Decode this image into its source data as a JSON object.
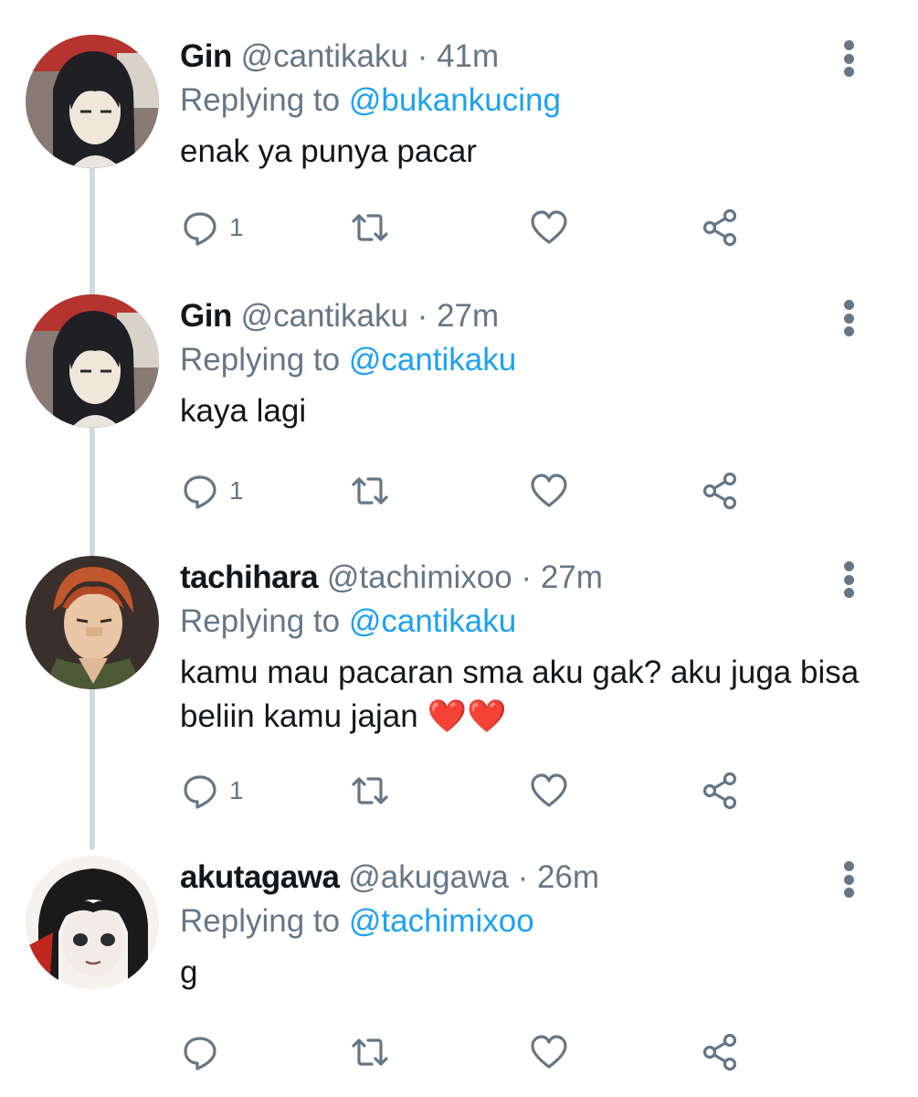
{
  "tweets": [
    {
      "display_name": "Gin",
      "handle": "@cantikaku",
      "separator": "·",
      "time": "41m",
      "replying_prefix": "Replying to",
      "replying_to": "@bukankucing",
      "text": "enak ya punya pacar",
      "emoji": "",
      "reply_count": "1",
      "avatar": "gin-avatar"
    },
    {
      "display_name": "Gin",
      "handle": "@cantikaku",
      "separator": "·",
      "time": "27m",
      "replying_prefix": "Replying to",
      "replying_to": "@cantikaku",
      "text": "kaya lagi",
      "emoji": "",
      "reply_count": "1",
      "avatar": "gin-avatar"
    },
    {
      "display_name": "tachihara",
      "handle": "@tachimixoo",
      "separator": "·",
      "time": "27m",
      "replying_prefix": "Replying to",
      "replying_to": "@cantikaku",
      "text": "kamu mau pacaran sma aku gak? aku juga bisa beliin kamu jajan ",
      "emoji": "❤️❤️",
      "reply_count": "1",
      "avatar": "tachihara-avatar"
    },
    {
      "display_name": "akutagawa",
      "handle": "@akugawa",
      "separator": "·",
      "time": "26m",
      "replying_prefix": "Replying to",
      "replying_to": "@tachimixoo",
      "text": "g",
      "emoji": "",
      "reply_count": "",
      "avatar": "akutagawa-avatar"
    }
  ],
  "icons": {
    "reply": "reply-icon",
    "retweet": "retweet-icon",
    "like": "heart-icon",
    "share": "share-icon",
    "more": "more-vertical-icon"
  },
  "colors": {
    "accent": "#1da1f2",
    "secondary_text": "#657786",
    "thread_line": "#cfd9de"
  }
}
